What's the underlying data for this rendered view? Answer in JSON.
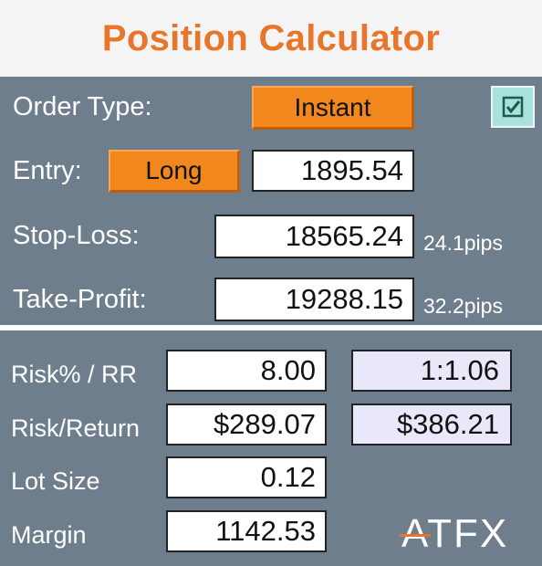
{
  "title": "Position Calculator",
  "order_type": {
    "label": "Order Type:",
    "value": "Instant",
    "checkbox_checked": true
  },
  "entry": {
    "label": "Entry:",
    "direction": "Long",
    "price": "1895.54"
  },
  "stop_loss": {
    "label": "Stop-Loss:",
    "price": "18565.24",
    "pips": "24.1pips"
  },
  "take_profit": {
    "label": "Take-Profit:",
    "price": "19288.15",
    "pips": "32.2pips"
  },
  "risk": {
    "label": "Risk% / RR",
    "percent": "8.00",
    "rr": "1:1.06"
  },
  "risk_return": {
    "label": "Risk/Return",
    "risk": "$289.07",
    "return": "$386.21"
  },
  "lot_size": {
    "label": "Lot Size",
    "value": "0.12"
  },
  "margin": {
    "label": "Margin",
    "value": "1142.53"
  },
  "brand": "ATFX",
  "colors": {
    "accent_orange": "#f2871e",
    "title_orange": "#e8762a",
    "panel": "#6e7e8d",
    "readonly_field": "#e8e8fa",
    "checkbox": "#a9e2dd"
  }
}
